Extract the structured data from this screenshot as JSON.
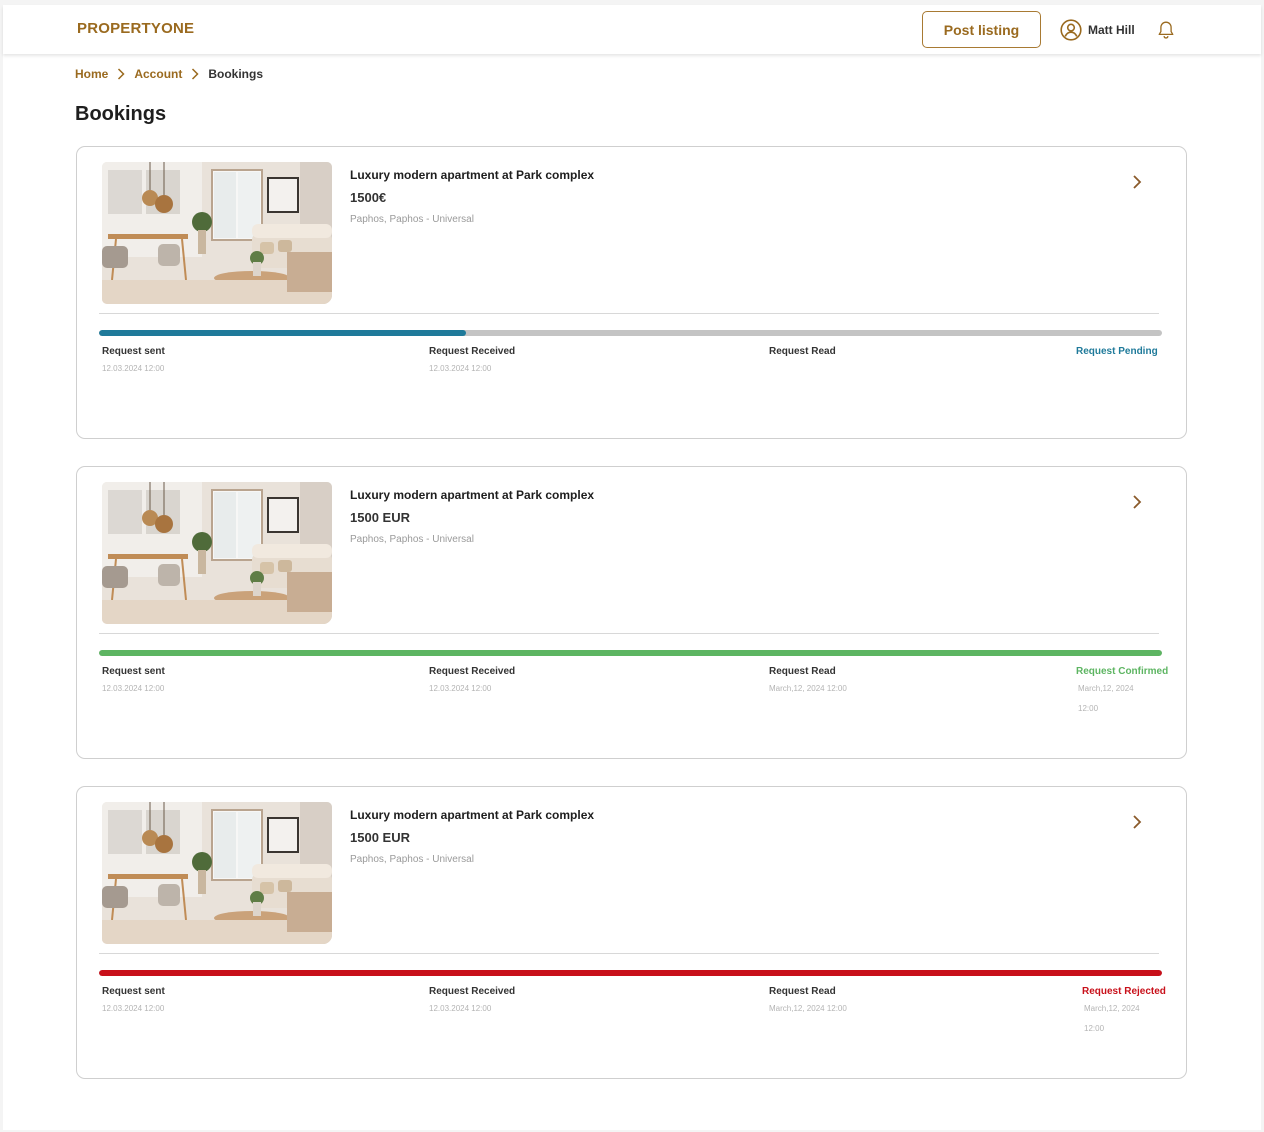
{
  "header": {
    "logo": "PROPERTYONE",
    "post_listing": "Post listing",
    "user_name": "Matt Hill"
  },
  "breadcrumb": [
    "Home",
    "Account",
    "Bookings"
  ],
  "page_title": "Bookings",
  "colors": {
    "brand": "#9a6a1f",
    "pending": "#1f7a9a",
    "confirmed": "#5db562",
    "rejected": "#c8101a",
    "track": "#c4c4c4"
  },
  "bookings": [
    {
      "title": "Luxury modern apartment at Park complex",
      "price": "1500€",
      "location": "Paphos, Paphos - Universal",
      "progress": 0.345,
      "steps": {
        "sent": {
          "label": "Request sent",
          "date": "12.03.2024 12:00"
        },
        "received": {
          "label": "Request Received",
          "date": "12.03.2024 12:00"
        },
        "read": {
          "label": "Request Read",
          "date": ""
        },
        "status": {
          "label": "Request Pending",
          "date": "",
          "time": ""
        }
      }
    },
    {
      "title": "Luxury modern apartment at Park complex",
      "price": "1500 EUR",
      "location": "Paphos, Paphos - Universal",
      "progress": 1.0,
      "steps": {
        "sent": {
          "label": "Request sent",
          "date": "12.03.2024 12:00"
        },
        "received": {
          "label": "Request Received",
          "date": "12.03.2024 12:00"
        },
        "read": {
          "label": "Request Read",
          "date": "March,12, 2024 12:00"
        },
        "status": {
          "label": "Request Confirmed",
          "date": "March,12, 2024",
          "time": "12:00"
        }
      }
    },
    {
      "title": "Luxury modern apartment at Park complex",
      "price": "1500 EUR",
      "location": "Paphos, Paphos - Universal",
      "progress": 1.0,
      "steps": {
        "sent": {
          "label": "Request sent",
          "date": "12.03.2024 12:00"
        },
        "received": {
          "label": "Request Received",
          "date": "12.03.2024 12:00"
        },
        "read": {
          "label": "Request Read",
          "date": "March,12, 2024 12:00"
        },
        "status": {
          "label": "Request Rejected",
          "date": "March,12, 2024",
          "time": "12:00"
        }
      }
    }
  ]
}
